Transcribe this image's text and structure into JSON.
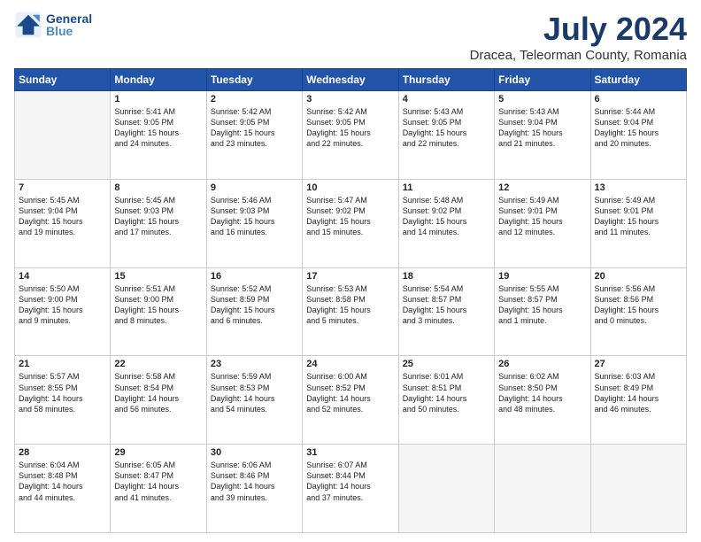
{
  "header": {
    "logo_line1": "General",
    "logo_line2": "Blue",
    "month": "July 2024",
    "location": "Dracea, Teleorman County, Romania"
  },
  "weekdays": [
    "Sunday",
    "Monday",
    "Tuesday",
    "Wednesday",
    "Thursday",
    "Friday",
    "Saturday"
  ],
  "weeks": [
    [
      {
        "day": "",
        "info": ""
      },
      {
        "day": "1",
        "info": "Sunrise: 5:41 AM\nSunset: 9:05 PM\nDaylight: 15 hours\nand 24 minutes."
      },
      {
        "day": "2",
        "info": "Sunrise: 5:42 AM\nSunset: 9:05 PM\nDaylight: 15 hours\nand 23 minutes."
      },
      {
        "day": "3",
        "info": "Sunrise: 5:42 AM\nSunset: 9:05 PM\nDaylight: 15 hours\nand 22 minutes."
      },
      {
        "day": "4",
        "info": "Sunrise: 5:43 AM\nSunset: 9:05 PM\nDaylight: 15 hours\nand 22 minutes."
      },
      {
        "day": "5",
        "info": "Sunrise: 5:43 AM\nSunset: 9:04 PM\nDaylight: 15 hours\nand 21 minutes."
      },
      {
        "day": "6",
        "info": "Sunrise: 5:44 AM\nSunset: 9:04 PM\nDaylight: 15 hours\nand 20 minutes."
      }
    ],
    [
      {
        "day": "7",
        "info": "Sunrise: 5:45 AM\nSunset: 9:04 PM\nDaylight: 15 hours\nand 19 minutes."
      },
      {
        "day": "8",
        "info": "Sunrise: 5:45 AM\nSunset: 9:03 PM\nDaylight: 15 hours\nand 17 minutes."
      },
      {
        "day": "9",
        "info": "Sunrise: 5:46 AM\nSunset: 9:03 PM\nDaylight: 15 hours\nand 16 minutes."
      },
      {
        "day": "10",
        "info": "Sunrise: 5:47 AM\nSunset: 9:02 PM\nDaylight: 15 hours\nand 15 minutes."
      },
      {
        "day": "11",
        "info": "Sunrise: 5:48 AM\nSunset: 9:02 PM\nDaylight: 15 hours\nand 14 minutes."
      },
      {
        "day": "12",
        "info": "Sunrise: 5:49 AM\nSunset: 9:01 PM\nDaylight: 15 hours\nand 12 minutes."
      },
      {
        "day": "13",
        "info": "Sunrise: 5:49 AM\nSunset: 9:01 PM\nDaylight: 15 hours\nand 11 minutes."
      }
    ],
    [
      {
        "day": "14",
        "info": "Sunrise: 5:50 AM\nSunset: 9:00 PM\nDaylight: 15 hours\nand 9 minutes."
      },
      {
        "day": "15",
        "info": "Sunrise: 5:51 AM\nSunset: 9:00 PM\nDaylight: 15 hours\nand 8 minutes."
      },
      {
        "day": "16",
        "info": "Sunrise: 5:52 AM\nSunset: 8:59 PM\nDaylight: 15 hours\nand 6 minutes."
      },
      {
        "day": "17",
        "info": "Sunrise: 5:53 AM\nSunset: 8:58 PM\nDaylight: 15 hours\nand 5 minutes."
      },
      {
        "day": "18",
        "info": "Sunrise: 5:54 AM\nSunset: 8:57 PM\nDaylight: 15 hours\nand 3 minutes."
      },
      {
        "day": "19",
        "info": "Sunrise: 5:55 AM\nSunset: 8:57 PM\nDaylight: 15 hours\nand 1 minute."
      },
      {
        "day": "20",
        "info": "Sunrise: 5:56 AM\nSunset: 8:56 PM\nDaylight: 15 hours\nand 0 minutes."
      }
    ],
    [
      {
        "day": "21",
        "info": "Sunrise: 5:57 AM\nSunset: 8:55 PM\nDaylight: 14 hours\nand 58 minutes."
      },
      {
        "day": "22",
        "info": "Sunrise: 5:58 AM\nSunset: 8:54 PM\nDaylight: 14 hours\nand 56 minutes."
      },
      {
        "day": "23",
        "info": "Sunrise: 5:59 AM\nSunset: 8:53 PM\nDaylight: 14 hours\nand 54 minutes."
      },
      {
        "day": "24",
        "info": "Sunrise: 6:00 AM\nSunset: 8:52 PM\nDaylight: 14 hours\nand 52 minutes."
      },
      {
        "day": "25",
        "info": "Sunrise: 6:01 AM\nSunset: 8:51 PM\nDaylight: 14 hours\nand 50 minutes."
      },
      {
        "day": "26",
        "info": "Sunrise: 6:02 AM\nSunset: 8:50 PM\nDaylight: 14 hours\nand 48 minutes."
      },
      {
        "day": "27",
        "info": "Sunrise: 6:03 AM\nSunset: 8:49 PM\nDaylight: 14 hours\nand 46 minutes."
      }
    ],
    [
      {
        "day": "28",
        "info": "Sunrise: 6:04 AM\nSunset: 8:48 PM\nDaylight: 14 hours\nand 44 minutes."
      },
      {
        "day": "29",
        "info": "Sunrise: 6:05 AM\nSunset: 8:47 PM\nDaylight: 14 hours\nand 41 minutes."
      },
      {
        "day": "30",
        "info": "Sunrise: 6:06 AM\nSunset: 8:46 PM\nDaylight: 14 hours\nand 39 minutes."
      },
      {
        "day": "31",
        "info": "Sunrise: 6:07 AM\nSunset: 8:44 PM\nDaylight: 14 hours\nand 37 minutes."
      },
      {
        "day": "",
        "info": ""
      },
      {
        "day": "",
        "info": ""
      },
      {
        "day": "",
        "info": ""
      }
    ]
  ]
}
